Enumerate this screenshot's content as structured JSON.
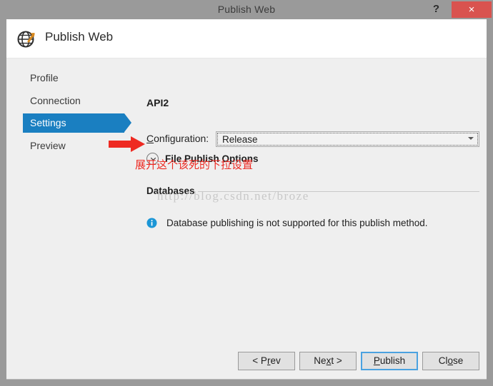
{
  "window": {
    "title": "Publish Web",
    "help_label": "?",
    "close_label": "×"
  },
  "header": {
    "title": "Publish Web",
    "icon": "globe-publish-icon"
  },
  "sidebar": {
    "items": [
      {
        "label": "Profile",
        "selected": false
      },
      {
        "label": "Connection",
        "selected": false
      },
      {
        "label": "Settings",
        "selected": true
      },
      {
        "label": "Preview",
        "selected": false
      }
    ],
    "selected_color": "#1a7fc1"
  },
  "main": {
    "profile_name": "API2",
    "configuration": {
      "label_prefix": "C",
      "label_rest": "onfiguration:",
      "value": "Release",
      "arrow_icon": "chevron-down-icon"
    },
    "file_publish_options": {
      "label": "File Publish Options",
      "expander_icon": "chevron-down-circle-icon",
      "expanded": false
    },
    "databases": {
      "title": "Databases",
      "info_icon": "info-icon",
      "message": "Database publishing is not supported for this publish method."
    }
  },
  "annotations": {
    "arrow_icon": "red-right-arrow-icon",
    "arrow_color": "#ee2a22",
    "text": "展开这个该死的下拉设置",
    "text_color": "#ee2a22"
  },
  "watermark": {
    "text": "http://blog.csdn.net/broze"
  },
  "footer": {
    "buttons": [
      {
        "name": "prev",
        "before": "< P",
        "mnemonic": "r",
        "after": "ev",
        "primary": false
      },
      {
        "name": "next",
        "before": "Ne",
        "mnemonic": "x",
        "after": "t >",
        "primary": false
      },
      {
        "name": "publish",
        "before": "",
        "mnemonic": "P",
        "after": "ublish",
        "primary": true
      },
      {
        "name": "close",
        "before": "Cl",
        "mnemonic": "o",
        "after": "se",
        "primary": false
      }
    ]
  },
  "colors": {
    "accent": "#1a7fc1",
    "close_button": "#d9534f",
    "titlebar": "#9a9a9a",
    "dialog_bg": "#efefef",
    "focus_border": "#4ba2e0"
  }
}
